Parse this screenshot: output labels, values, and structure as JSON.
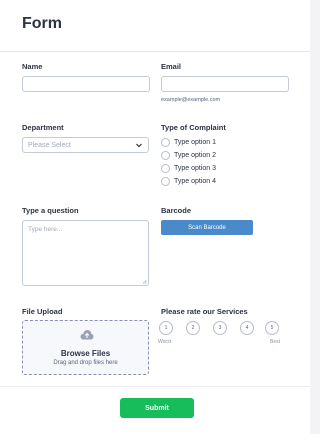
{
  "form": {
    "title": "Form"
  },
  "fields": {
    "name": {
      "label": "Name",
      "value": ""
    },
    "email": {
      "label": "Email",
      "value": "",
      "sublabel": "example@example.com"
    },
    "department": {
      "label": "Department",
      "selected": "Please Select"
    },
    "complaint": {
      "label": "Type of Complaint",
      "options": [
        "Type option 1",
        "Type option 2",
        "Type option 3",
        "Type option 4"
      ]
    },
    "question": {
      "label": "Type a question",
      "placeholder": "Type here..."
    },
    "barcode": {
      "label": "Barcode",
      "button_label": "Scan Barcode"
    },
    "upload": {
      "label": "File Upload",
      "title": "Browse Files",
      "subtitle": "Drag and drop files here"
    },
    "rating": {
      "label": "Please rate our Services",
      "values": [
        "1",
        "2",
        "3",
        "4",
        "5"
      ],
      "low_label": "Worst",
      "high_label": "Best"
    }
  },
  "actions": {
    "submit_label": "Submit"
  },
  "colors": {
    "primary": "#4a8acb",
    "submit": "#18bd5b",
    "text": "#2c3345",
    "border": "#c3cad8"
  },
  "icons": {
    "upload": "cloud-upload-icon",
    "select": "chevron-down-icon"
  }
}
